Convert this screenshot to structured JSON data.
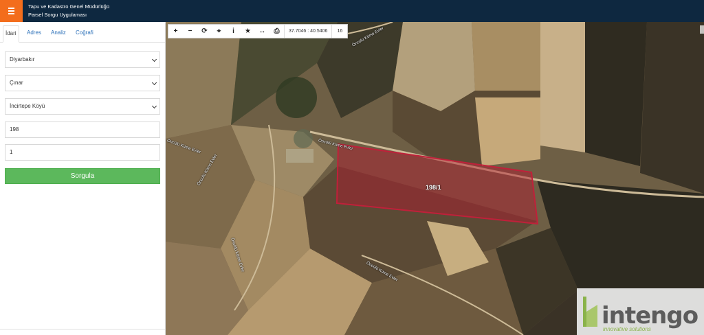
{
  "header": {
    "title_line1": "Tapu ve Kadastro Genel Müdürlüğü",
    "title_line2": "Parsel Sorgu Uygulaması"
  },
  "sidebar": {
    "tabs": [
      {
        "label": "İdari",
        "active": true
      },
      {
        "label": "Adres",
        "active": false
      },
      {
        "label": "Analiz",
        "active": false
      },
      {
        "label": "Coğrafi",
        "active": false
      }
    ],
    "fields": {
      "province": "Diyarbakır",
      "district": "Çınar",
      "village": "İncirtepe Köyü",
      "block": "198",
      "parcel": "1"
    },
    "query_button": "Sorgula"
  },
  "map": {
    "toolbar": {
      "icons": [
        "zoom-in-icon",
        "zoom-out-icon",
        "refresh-icon",
        "locate-icon",
        "info-icon",
        "star-icon",
        "measure-icon",
        "print-icon"
      ],
      "coordinates": "37.7046 : 40.5406",
      "zoom": "16"
    },
    "road_labels": [
      "Öncülü Küme Evler",
      "Öncülü Küme Evler",
      "Öncülü Küme Evler",
      "Öncülü Küme Evler",
      "Öncülü Küme Evler",
      "Öncülü Küme Evler"
    ],
    "parcel_label": "198/1",
    "parcel_color": "#c0203a",
    "watermark": {
      "name": "intengo",
      "tagline": "innovative solutions"
    }
  },
  "colors": {
    "header_bg": "#0e2840",
    "menu_button": "#f36d1c",
    "tab_link": "#2a6fb8",
    "query_button": "#5cb85c"
  }
}
